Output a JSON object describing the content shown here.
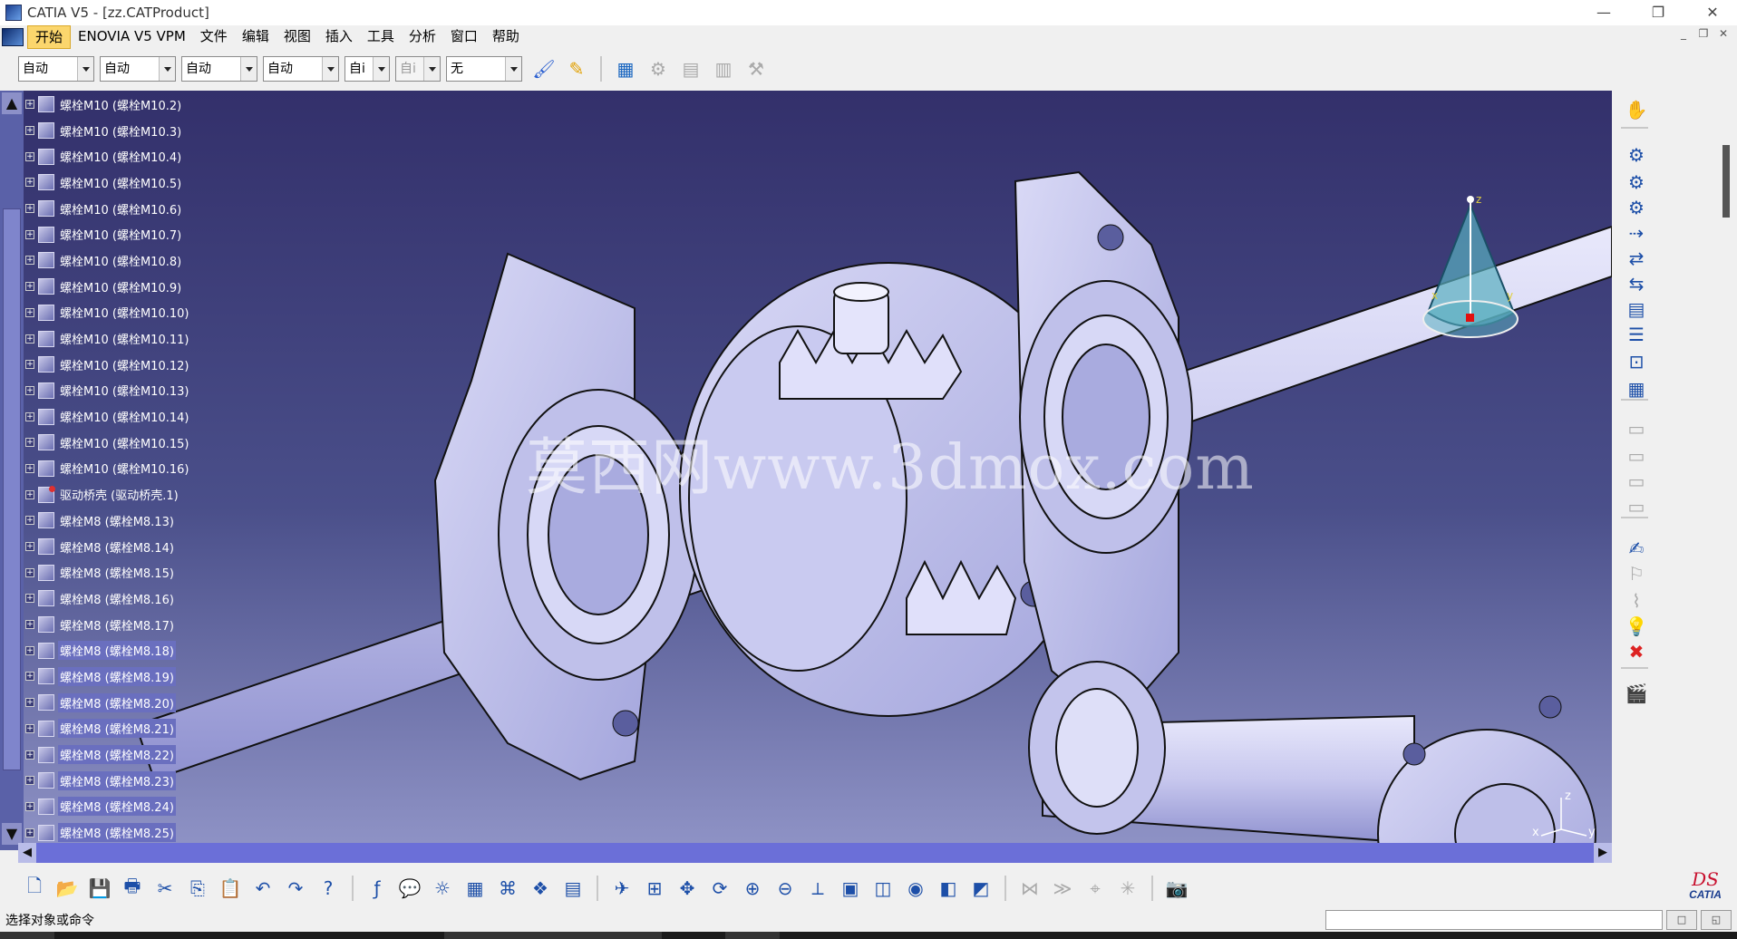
{
  "window": {
    "title": "CATIA V5 - [zz.CATProduct]",
    "minimize": "—",
    "restore": "❐",
    "close": "✕"
  },
  "menu": [
    {
      "label": "开始",
      "active": true
    },
    {
      "label": "ENOVIA V5 VPM",
      "active": false
    },
    {
      "label": "文件",
      "active": false
    },
    {
      "label": "编辑",
      "active": false
    },
    {
      "label": "视图",
      "active": false
    },
    {
      "label": "插入",
      "active": false
    },
    {
      "label": "工具",
      "active": false
    },
    {
      "label": "分析",
      "active": false
    },
    {
      "label": "窗口",
      "active": false
    },
    {
      "label": "帮助",
      "active": false
    }
  ],
  "mdi_controls": {
    "min": "_",
    "restore": "❐",
    "close": "✕"
  },
  "toolbar1": {
    "combos": [
      {
        "value": "自动",
        "disabled": false
      },
      {
        "value": "自动",
        "disabled": false
      },
      {
        "value": "自动",
        "disabled": false
      },
      {
        "value": "自动",
        "disabled": false
      },
      {
        "value": "自i",
        "disabled": false
      },
      {
        "value": "自i",
        "disabled": true
      },
      {
        "value": "无",
        "disabled": false
      }
    ],
    "icons": [
      "paintbrush-icon",
      "painter-icon",
      "properties-icon",
      "gear-disabled-icon",
      "grid-disabled-icon",
      "matrix-disabled-icon",
      "tools-disabled-icon"
    ]
  },
  "tree": [
    {
      "label": "螺栓M10 (螺栓M10.2)",
      "selected": false,
      "red": false
    },
    {
      "label": "螺栓M10 (螺栓M10.3)",
      "selected": false,
      "red": false
    },
    {
      "label": "螺栓M10 (螺栓M10.4)",
      "selected": false,
      "red": false
    },
    {
      "label": "螺栓M10 (螺栓M10.5)",
      "selected": false,
      "red": false
    },
    {
      "label": "螺栓M10 (螺栓M10.6)",
      "selected": false,
      "red": false
    },
    {
      "label": "螺栓M10 (螺栓M10.7)",
      "selected": false,
      "red": false
    },
    {
      "label": "螺栓M10 (螺栓M10.8)",
      "selected": false,
      "red": false
    },
    {
      "label": "螺栓M10 (螺栓M10.9)",
      "selected": false,
      "red": false
    },
    {
      "label": "螺栓M10 (螺栓M10.10)",
      "selected": false,
      "red": false
    },
    {
      "label": "螺栓M10 (螺栓M10.11)",
      "selected": false,
      "red": false
    },
    {
      "label": "螺栓M10 (螺栓M10.12)",
      "selected": false,
      "red": false
    },
    {
      "label": "螺栓M10 (螺栓M10.13)",
      "selected": false,
      "red": false
    },
    {
      "label": "螺栓M10 (螺栓M10.14)",
      "selected": false,
      "red": false
    },
    {
      "label": "螺栓M10 (螺栓M10.15)",
      "selected": false,
      "red": false
    },
    {
      "label": "螺栓M10 (螺栓M10.16)",
      "selected": false,
      "red": false
    },
    {
      "label": "驱动桥壳 (驱动桥壳.1)",
      "selected": false,
      "red": true
    },
    {
      "label": "螺栓M8 (螺栓M8.13)",
      "selected": false,
      "red": false
    },
    {
      "label": "螺栓M8 (螺栓M8.14)",
      "selected": false,
      "red": false
    },
    {
      "label": "螺栓M8 (螺栓M8.15)",
      "selected": false,
      "red": false
    },
    {
      "label": "螺栓M8 (螺栓M8.16)",
      "selected": false,
      "red": false
    },
    {
      "label": "螺栓M8 (螺栓M8.17)",
      "selected": false,
      "red": false
    },
    {
      "label": "螺栓M8 (螺栓M8.18)",
      "selected": true,
      "red": false
    },
    {
      "label": "螺栓M8 (螺栓M8.19)",
      "selected": true,
      "red": false
    },
    {
      "label": "螺栓M8 (螺栓M8.20)",
      "selected": true,
      "red": false
    },
    {
      "label": "螺栓M8 (螺栓M8.21)",
      "selected": true,
      "red": false
    },
    {
      "label": "螺栓M8 (螺栓M8.22)",
      "selected": true,
      "red": false
    },
    {
      "label": "螺栓M8 (螺栓M8.23)",
      "selected": true,
      "red": false
    },
    {
      "label": "螺栓M8 (螺栓M8.24)",
      "selected": true,
      "red": false
    },
    {
      "label": "螺栓M8 (螺栓M8.25)",
      "selected": true,
      "red": false
    }
  ],
  "viewport": {
    "watermark": "莫西网www.3dmox.com",
    "compass": {
      "x": "x",
      "y": "y",
      "z": "z"
    },
    "axis": {
      "x": "x",
      "y": "y",
      "z": "z"
    }
  },
  "toolbar2": {
    "icons": [
      "new-file-icon",
      "open-file-icon",
      "save-icon",
      "print-icon",
      "cut-icon",
      "copy-icon",
      "paste-icon",
      "undo-icon",
      "redo-icon",
      "whats-this-icon",
      "formula-icon",
      "comment-icon",
      "light-icon",
      "table-icon",
      "tree-icon",
      "catalog-icon",
      "design-table-icon",
      "fly-mode-icon",
      "fit-all-icon",
      "pan-icon",
      "rotate-icon",
      "zoom-in-icon",
      "zoom-out-icon",
      "normal-view-icon",
      "multi-view-icon",
      "iso-view-icon",
      "shading-icon",
      "hide-show-icon",
      "swap-visible-icon",
      "split-disabled-icon",
      "snap-disabled-icon",
      "manip-disabled-icon",
      "explode-disabled-icon",
      "capture-icon"
    ]
  },
  "rightbar": {
    "icons": [
      "manipulate-icon",
      "fix-constraint-icon",
      "coincidence-icon",
      "contact-icon",
      "offset-icon",
      "angle-icon",
      "fix-together-icon",
      "reuse-pattern-icon",
      "bill-of-material-icon",
      "snap-icon",
      "existing-component-icon",
      "scene-disabled-icon",
      "scene2-disabled-icon",
      "scene3-disabled-icon",
      "scene4-disabled-icon",
      "annotation-icon",
      "flag-disabled-icon",
      "weld-disabled-icon",
      "light-bulb-icon",
      "clash-icon",
      "group-icon"
    ]
  },
  "status": {
    "text": "选择对象或命令",
    "btn1": "□",
    "btn2": "◱"
  }
}
